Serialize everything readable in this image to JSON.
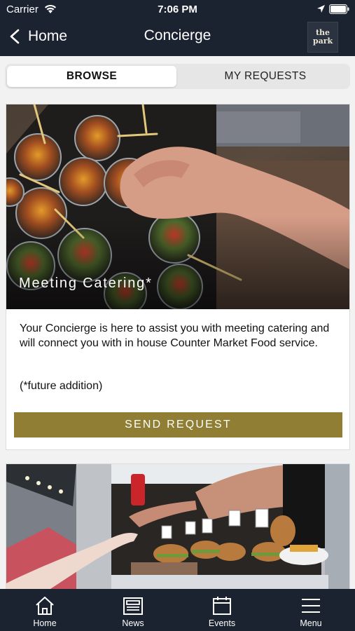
{
  "status": {
    "carrier": "Carrier",
    "time": "7:06 PM"
  },
  "nav": {
    "back_label": "Home",
    "title": "Concierge",
    "logo_line1": "the",
    "logo_line2": "park"
  },
  "segments": {
    "browse": "BROWSE",
    "my_requests": "MY REQUESTS"
  },
  "cards": [
    {
      "caption": "Meeting Catering*",
      "description": "Your Concierge is here to assist you with meeting catering and will connect you with in house Counter Market Food service.",
      "note": "(*future addition)",
      "button": "SEND REQUEST"
    }
  ],
  "tabbar": {
    "home": "Home",
    "news": "News",
    "events": "Events",
    "menu": "Menu"
  },
  "colors": {
    "nav_bg": "#1b2230",
    "accent": "#8f7e33",
    "page_bg": "#f2f2f2"
  }
}
